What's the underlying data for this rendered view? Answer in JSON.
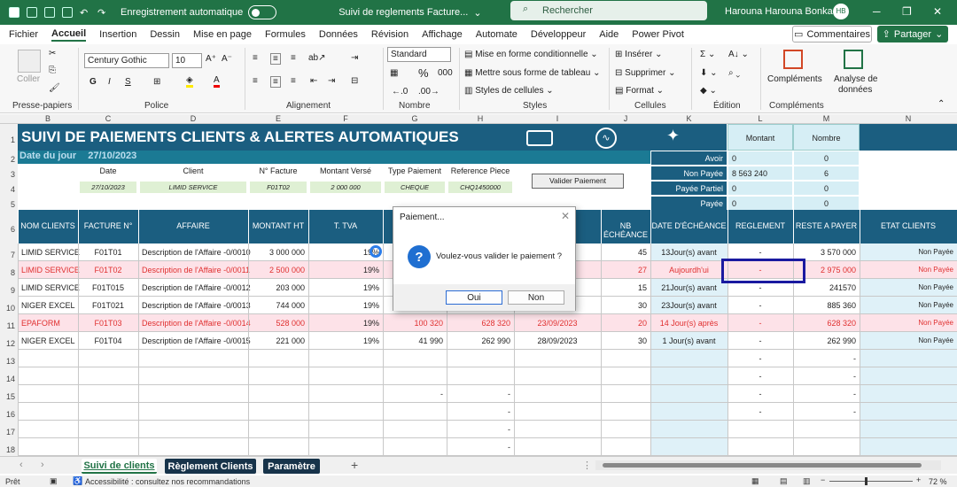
{
  "titlebar": {
    "autosave": "Enregistrement automatique",
    "doc_title": "Suivi de reglements Facture...",
    "search_placeholder": "Rechercher",
    "user": "Harouna Harouna Bonkano",
    "avatar": "HB"
  },
  "menu": [
    "Fichier",
    "Accueil",
    "Insertion",
    "Dessin",
    "Mise en page",
    "Formules",
    "Données",
    "Révision",
    "Affichage",
    "Automate",
    "Développeur",
    "Aide",
    "Power Pivot"
  ],
  "menu_active": "Accueil",
  "comments_label": "Commentaires",
  "share_label": "Partager",
  "ribbon": {
    "paste": "Coller",
    "clipboard": "Presse-papiers",
    "font_name": "Century Gothic",
    "font_size": "10",
    "police": "Police",
    "alignment": "Alignement",
    "number_format": "Standard",
    "nombre": "Nombre",
    "cond_format": "Mise en forme conditionnelle",
    "table_format": "Mettre sous forme de tableau",
    "cell_styles": "Styles de cellules",
    "styles": "Styles",
    "insert": "Insérer",
    "delete": "Supprimer",
    "format": "Format",
    "cells": "Cellules",
    "edition": "Édition",
    "addins": "Compléments",
    "addins_grp": "Compléments",
    "analyze": "Analyse de",
    "analyze2": "données"
  },
  "columns": [
    "B",
    "C",
    "D",
    "E",
    "F",
    "G",
    "H",
    "I",
    "J",
    "K",
    "L",
    "M",
    "N"
  ],
  "rows": [
    "1",
    "2",
    "3",
    "4",
    "5",
    "6",
    "7",
    "8",
    "9",
    "10",
    "11",
    "12",
    "13",
    "14",
    "15",
    "16",
    "17",
    "18"
  ],
  "sheet": {
    "title": "SUIVI DE PAIEMENTS CLIENTS & ALERTES AUTOMATIQUES",
    "date_label": "Date du jour",
    "date_value": "27/10/2023",
    "form_headers": [
      "Date",
      "Client",
      "N° Facture",
      "Montant Versé",
      "Type Paiement",
      "Reference Piece"
    ],
    "form_values": [
      "27/10/2023",
      "LIMID SERVICE",
      "F01T02",
      "2 000 000",
      "CHEQUE",
      "CHQ1450000"
    ],
    "validate_btn": "Valider Paiement",
    "summary_headers": [
      "Montant",
      "Nombre"
    ],
    "summary": [
      {
        "label": "Avoir",
        "montant": "0",
        "nombre": "0"
      },
      {
        "label": "Non Payée",
        "montant": "8 563 240",
        "nombre": "6"
      },
      {
        "label": "Payée Partiel",
        "montant": "0",
        "nombre": "0"
      },
      {
        "label": "Payée",
        "montant": "0",
        "nombre": "0"
      }
    ],
    "table_headers": [
      "NOM CLIENTS",
      "FACTURE N°",
      "AFFAIRE",
      "MONTANT HT",
      "T. TVA",
      "",
      "",
      "ON",
      "NB ÉCHÉANCE",
      "DATE D'ÉCHÉANCE",
      "REGLEMENT",
      "RESTE A PAYER",
      "ETAT CLIENTS"
    ],
    "data": [
      {
        "client": "LIMID SERVICE",
        "facture": "F01T01",
        "affaire": "Description de l'Affaire -0/0010",
        "ht": "3 000 000",
        "tva": "19%",
        "g": "",
        "h": "",
        "i": "",
        "nb": "45",
        "date": "13Jour(s) avant",
        "regl": "-",
        "reste": "3 570 000",
        "etat": "Non Payée",
        "style": "normal"
      },
      {
        "client": "LIMID SERVICE",
        "facture": "F01T02",
        "affaire": "Description de l'Affaire -0/0011",
        "ht": "2 500 000",
        "tva": "19%",
        "g": "",
        "h": "",
        "i": "",
        "nb": "27",
        "date": "Aujourdh'ui",
        "regl": "-",
        "reste": "2 975 000",
        "etat": "Non Payée",
        "style": "red"
      },
      {
        "client": "LIMID SERVICE",
        "facture": "F01T015",
        "affaire": "Description de l'Affaire -0/0012",
        "ht": "203 000",
        "tva": "19%",
        "g": "",
        "h": "",
        "i": "",
        "nb": "15",
        "date": "21Jour(s) avant",
        "regl": "-",
        "reste": "241570",
        "etat": "Non Payée",
        "style": "normal"
      },
      {
        "client": "NIGER EXCEL",
        "facture": "F01T021",
        "affaire": "Description de l'Affaire -0/0013",
        "ht": "744 000",
        "tva": "19%",
        "g": "",
        "h": "",
        "i": "",
        "nb": "30",
        "date": "23Jour(s) avant",
        "regl": "-",
        "reste": "885 360",
        "etat": "Non Payée",
        "style": "normal"
      },
      {
        "client": "EPAFORM",
        "facture": "F01T03",
        "affaire": "Description de l'Affaire -0/0014",
        "ht": "528 000",
        "tva": "19%",
        "g": "100 320",
        "h": "628 320",
        "i": "23/09/2023",
        "nb": "20",
        "date": "14 Jour(s) après",
        "regl": "-",
        "reste": "628 320",
        "etat": "Non Payée",
        "style": "red"
      },
      {
        "client": "NIGER EXCEL",
        "facture": "F01T04",
        "affaire": "Description de l'Affaire -0/0015",
        "ht": "221 000",
        "tva": "19%",
        "g": "41 990",
        "h": "262 990",
        "i": "28/09/2023",
        "nb": "30",
        "date": "1 Jour(s) avant",
        "regl": "-",
        "reste": "262 990",
        "etat": "Non Payée",
        "style": "normal"
      }
    ],
    "dash": "-"
  },
  "dialog": {
    "title": "Paiement...",
    "message": "Voulez-vous valider le paiement ?",
    "yes": "Oui",
    "no": "Non"
  },
  "tabs": [
    "Suivi de clients",
    "Règlement Clients",
    "Paramètre"
  ],
  "status": {
    "ready": "Prêt",
    "accessibility": "Accessibilité : consultez nos recommandations",
    "zoom": "72 %"
  },
  "colors": {
    "excel_green": "#217346",
    "header_blue": "#1b5e80",
    "alert_red": "#e03030",
    "pink_row": "#fde2e8"
  }
}
